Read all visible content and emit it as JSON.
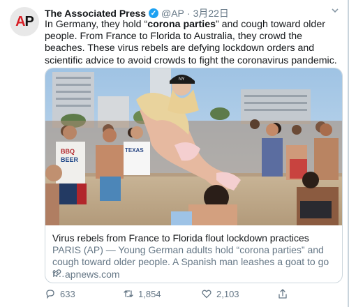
{
  "tweet": {
    "account_name": "The Associated Press",
    "handle": "@AP",
    "separator": "·",
    "date": "3月22日",
    "text_before": "In Germany, they hold “",
    "text_bold": "corona parties",
    "text_after": "” and cough toward older people. From France to Florida to Australia, they crowd the beaches. These virus rebels are defying lockdown orders and scientific advice to avoid crowds to fight the coronavirus pandemic."
  },
  "avatar": {
    "logo_text_red": "A",
    "logo_text_dark": "P"
  },
  "card": {
    "title": "Virus rebels from France to Florida flout lockdown practices",
    "description": "PARIS (AP) — Young German adults hold “corona parties” and cough toward older people. A Spanish man leashes a goat to go f…",
    "domain": "apnews.com",
    "photo_shirt_text_1": "BBQ",
    "photo_shirt_text_2": "BEER",
    "photo_shirt_text_3": "TEXAS",
    "photo_cap_text": "NY"
  },
  "actions": {
    "replies": "633",
    "retweets": "1,854",
    "likes": "2,103"
  },
  "colors": {
    "verified": "#1da1f2",
    "secondary_text": "#657786",
    "ap_red": "#d81f26"
  },
  "icons": [
    "chevron-down-icon",
    "verified-badge-icon",
    "link-icon",
    "reply-icon",
    "retweet-icon",
    "like-icon",
    "share-icon"
  ]
}
